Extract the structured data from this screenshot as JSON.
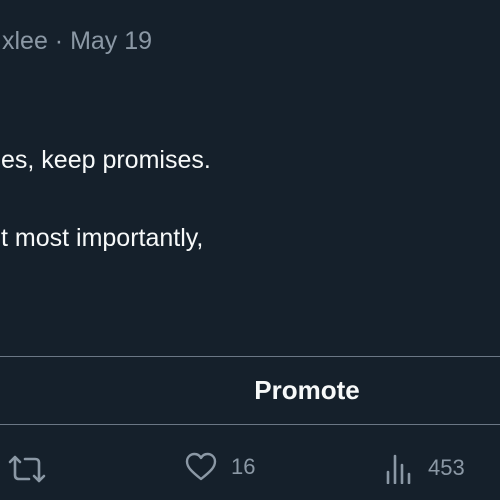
{
  "tweet": {
    "meta": "xlee · May 19",
    "lines": [
      "es, keep promises.",
      "t most importantly,"
    ]
  },
  "promote": {
    "label": "Promote"
  },
  "actions": {
    "retweet": {
      "icon": "retweet-icon"
    },
    "like": {
      "icon": "heart-icon",
      "count": "16"
    },
    "views": {
      "icon": "views-chart-icon",
      "count": "453"
    }
  },
  "colors": {
    "background": "#15202b",
    "text": "#f7f9f9",
    "muted": "#8b98a5",
    "divider": "#6b7785"
  }
}
